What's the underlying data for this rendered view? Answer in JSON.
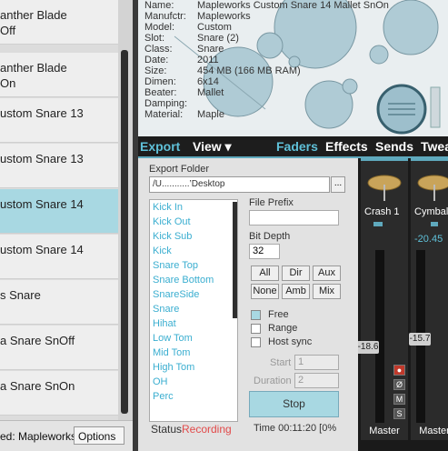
{
  "kits": [
    {
      "line1": "anther Blade",
      "line2": "Off"
    },
    {
      "line1": "anther Blade",
      "line2": "On"
    },
    {
      "line1": "ustom Snare 13",
      "line2": ""
    },
    {
      "line1": "ustom Snare 13",
      "line2": ""
    },
    {
      "line1": "ustom Snare 14",
      "line2": ""
    },
    {
      "line1": "ustom Snare 14",
      "line2": ""
    },
    {
      "line1": "s Snare",
      "line2": ""
    },
    {
      "line1": "a Snare SnOff",
      "line2": ""
    },
    {
      "line1": "a Snare SnOn",
      "line2": ""
    }
  ],
  "selected_index": 4,
  "statusbar": {
    "loaded": "ed: Mapleworks",
    "options": "Options"
  },
  "kit_info": [
    {
      "key": "Name:",
      "value": "Mapleworks Custom Snare 14 Mallet SnOn"
    },
    {
      "key": "Manufctr:",
      "value": "Mapleworks"
    },
    {
      "key": "Model:",
      "value": "Custom"
    },
    {
      "key": "Slot:",
      "value": "Snare (2)"
    },
    {
      "key": "Class:",
      "value": "Snare"
    },
    {
      "key": "Date:",
      "value": "2011"
    },
    {
      "key": "Size:",
      "value": "454 MB (166 MB RAM)"
    },
    {
      "key": "Dimen:",
      "value": "6x14"
    },
    {
      "key": "Beater:",
      "value": "Mallet"
    },
    {
      "key": "Damping:",
      "value": ""
    },
    {
      "key": "Material:",
      "value": "Maple"
    }
  ],
  "tabs": {
    "export": "Export",
    "view": "View ▾",
    "faders": "Faders",
    "effects": "Effects",
    "sends": "Sends",
    "tweak": "Twea"
  },
  "export": {
    "folder_label": "Export Folder",
    "folder_value": "/U...........’Desktop",
    "browse": "...",
    "channels": [
      "Kick In",
      "Kick Out",
      "Kick Sub",
      "Kick",
      "Snare Top",
      "Snare Bottom",
      "SnareSide",
      "Snare",
      "Hihat",
      "Low Tom",
      "Mid Tom",
      "High Tom",
      "OH",
      "Perc"
    ],
    "prefix_label": "File Prefix",
    "prefix_value": "",
    "bitdepth_label": "Bit Depth",
    "bitdepth_value": "32",
    "select_buttons": [
      "All",
      "Dir",
      "Aux",
      "None",
      "Amb",
      "Mix"
    ],
    "options": [
      {
        "label": "Free",
        "checked": true
      },
      {
        "label": "Range",
        "checked": false
      },
      {
        "label": "Host sync",
        "checked": false
      }
    ],
    "start_label": "Start",
    "start_value": "1",
    "duration_label": "Duration",
    "duration_value": "2",
    "stop_label": "Stop",
    "status_label": "Status",
    "status_value": "Recording",
    "time_text": "Time 00:11:20  [0%"
  },
  "mixer": {
    "channels": [
      {
        "name": "Crash 1",
        "volume": "",
        "fader_value": "-18.6",
        "output": "Master"
      },
      {
        "name": "Cymbal",
        "volume": "-20.45",
        "fader_value": "-15.7",
        "output": "Master"
      }
    ],
    "buttons": [
      "●",
      "Ø",
      "M",
      "S"
    ]
  },
  "colors": {
    "accent": "#5fc0d8",
    "selected": "#a8d8e2",
    "recording": "#e24a4a"
  }
}
